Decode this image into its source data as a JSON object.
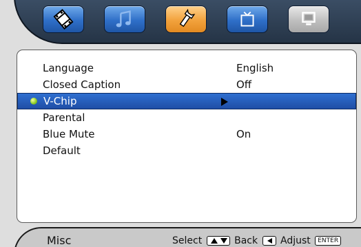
{
  "tabs": [
    {
      "icon": "film-icon",
      "state": "normal"
    },
    {
      "icon": "music-note-icon",
      "state": "normal"
    },
    {
      "icon": "wrench-icon",
      "state": "active"
    },
    {
      "icon": "tv-icon",
      "state": "normal"
    },
    {
      "icon": "monitor-icon",
      "state": "disabled"
    }
  ],
  "menu": {
    "items": [
      {
        "label": "Language",
        "value": "English"
      },
      {
        "label": "Closed Caption",
        "value": "Off"
      },
      {
        "label": "V-Chip",
        "value": ""
      },
      {
        "label": "Parental",
        "value": ""
      },
      {
        "label": "Blue Mute",
        "value": "On"
      },
      {
        "label": "Default",
        "value": ""
      }
    ],
    "selected": "V-Chip"
  },
  "footer": {
    "title": "Misc",
    "select_label": "Select",
    "back_label": "Back",
    "adjust_label": "Adjust",
    "enter_key": "ENTER"
  },
  "colors": {
    "tab_blue": "#2f6fc8",
    "tab_active": "#f2a23c",
    "selection": "#1f4ea6",
    "header": "#253446"
  }
}
